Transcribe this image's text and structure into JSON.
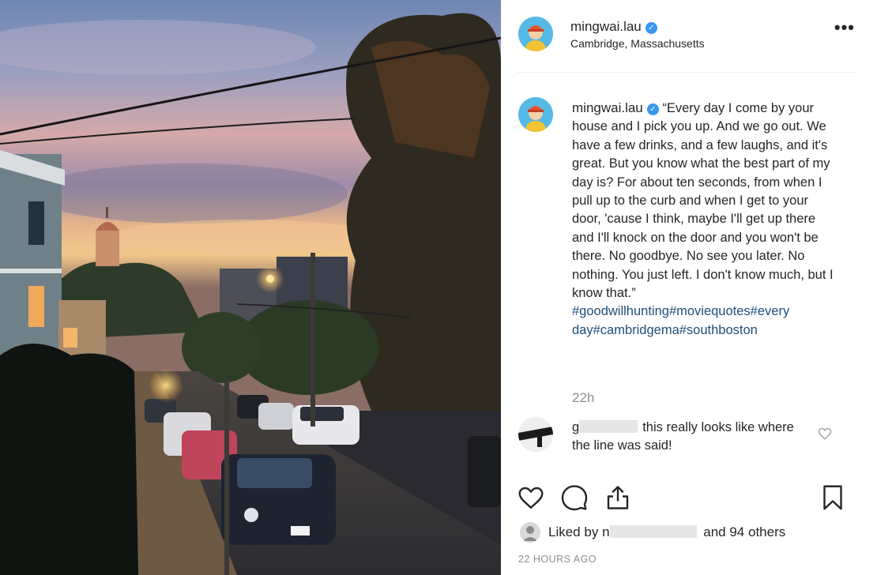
{
  "post": {
    "username": "mingwai.lau",
    "location": "Cambridge, Massachusetts",
    "verified_icon": "verified-badge-icon",
    "more_icon": "more-options-icon",
    "more_label": "•••",
    "caption_user": "mingwai.lau",
    "caption_text": "“Every day I come by your house and I pick you up. And we go out. We have a few drinks, and a few laughs, and it's great. But you know what the best part of my day is? For about ten seconds, from when I pull up to the curb and when I get to your door, 'cause I think, maybe I'll get up there and I'll knock on the door and you won't be there. No goodbye. No see you later. No nothing. You just left. I don't know much, but I know that.”",
    "hashtags": [
      "#goodwillhunting",
      "#moviequotes",
      "#every",
      "day",
      "#cambridgema",
      "#southboston"
    ],
    "time_short": "22h",
    "time_ago": "22 HOURS AGO"
  },
  "comment": {
    "user_visible": "g",
    "text": "this really looks like where the line was said!",
    "heart_icon": "heart-outline-icon"
  },
  "actions": {
    "like_icon": "heart-icon",
    "comment_icon": "comment-icon",
    "share_icon": "share-icon",
    "save_icon": "bookmark-icon"
  },
  "likes": {
    "prefix": "Liked by",
    "user_visible": "n",
    "suffix": "and 94 others"
  },
  "colors": {
    "verified": "#3897f0",
    "hashtag": "#1b4f7a",
    "muted": "#8e8e8e",
    "text": "#262626"
  }
}
